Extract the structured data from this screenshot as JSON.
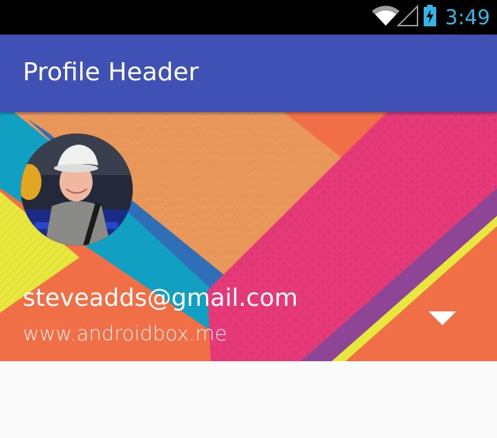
{
  "status_bar": {
    "time": "3:49",
    "icons": [
      "wifi-icon",
      "signal-icon",
      "battery-charging-icon"
    ],
    "accent_color": "#33b5e5"
  },
  "app_bar": {
    "title": "Profile Header",
    "color": "#3f51b5"
  },
  "profile": {
    "email": "steveadds@gmail.com",
    "website": "www.androidbox.me",
    "avatar": "profile-photo",
    "dropdown_icon": "arrow-drop-down-icon"
  },
  "colors": {
    "orange": "#f06f47",
    "peach": "#e8965a",
    "pink": "#e53a77",
    "purple": "#8e4596",
    "teal": "#12a0c2",
    "blue": "#2f6fb8",
    "yellow": "#e7e73d",
    "background": "#fafafa"
  }
}
